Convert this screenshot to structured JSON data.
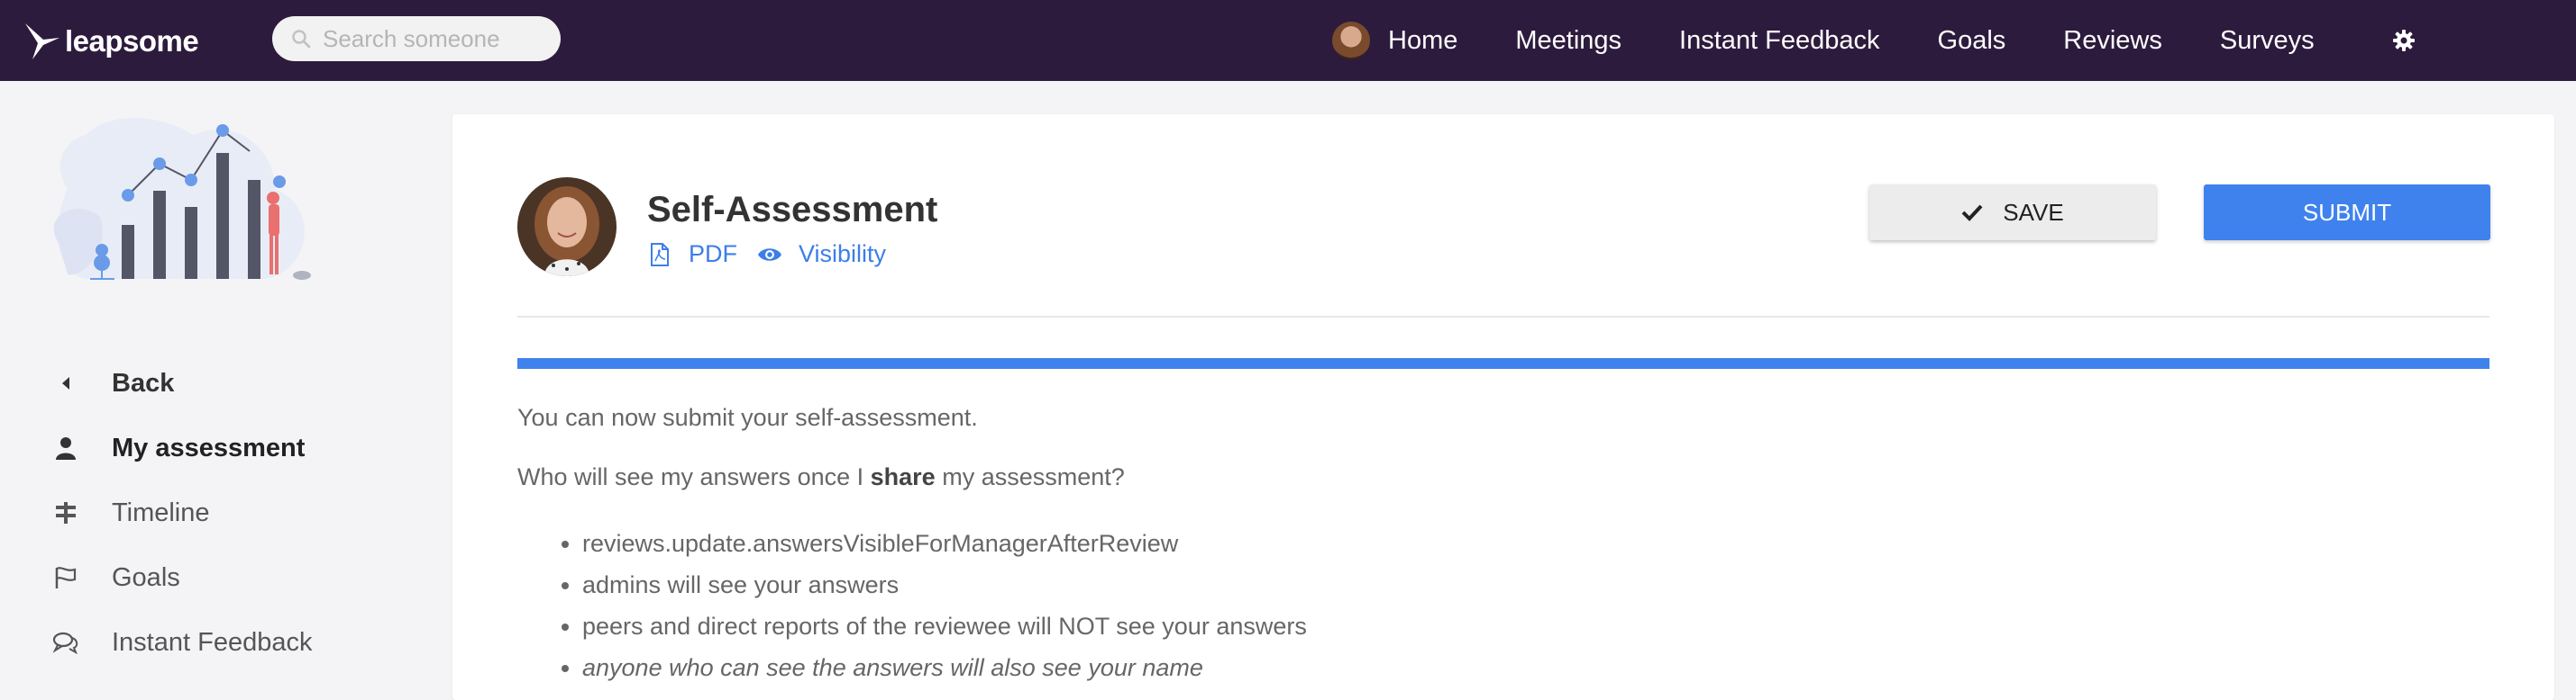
{
  "brand": {
    "name": "leapsome"
  },
  "search": {
    "placeholder": "Search someone"
  },
  "nav": {
    "items": [
      {
        "label": "Home"
      },
      {
        "label": "Meetings"
      },
      {
        "label": "Instant Feedback"
      },
      {
        "label": "Goals"
      },
      {
        "label": "Reviews"
      },
      {
        "label": "Surveys"
      }
    ],
    "settings_icon": "gear-icon"
  },
  "sidebar": {
    "items": [
      {
        "label": "Back",
        "icon": "caret-left-icon"
      },
      {
        "label": "My assessment",
        "icon": "user-icon"
      },
      {
        "label": "Timeline",
        "icon": "signpost-icon"
      },
      {
        "label": "Goals",
        "icon": "flag-icon"
      },
      {
        "label": "Instant Feedback",
        "icon": "comments-icon"
      }
    ]
  },
  "assessment": {
    "title": "Self-Assessment",
    "pdf_label": "PDF",
    "visibility_label": "Visibility",
    "save_label": "SAVE",
    "submit_label": "SUBMIT",
    "progress": 1.0,
    "intro": "You can now submit your self-assessment.",
    "question_prefix": "Who will see my answers once I ",
    "question_bold": "share",
    "question_suffix": " my assessment?",
    "bullets": [
      "reviews.update.answersVisibleForManagerAfterReview",
      "admins will see your answers",
      "peers and direct reports of the reviewee will NOT see your answers",
      "anyone who can see the answers will also see your name"
    ]
  },
  "colors": {
    "topbar": "#2d1b3d",
    "accent": "#3f82ee",
    "link": "#3d7ee8"
  }
}
